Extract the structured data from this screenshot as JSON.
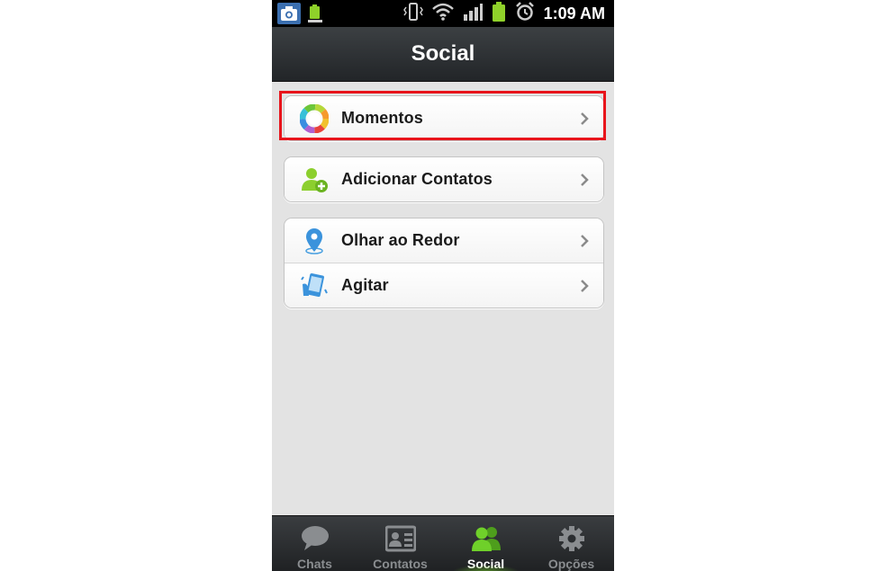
{
  "status_bar": {
    "time": "1:09 AM",
    "icons": [
      "camera-icon",
      "android-battery-notification-icon",
      "vibrate-icon",
      "wifi-icon",
      "signal-icon",
      "battery-icon",
      "alarm-icon"
    ]
  },
  "header": {
    "title": "Social"
  },
  "groups": [
    {
      "items": [
        {
          "label": "Momentos",
          "icon": "moments-icon"
        }
      ]
    },
    {
      "items": [
        {
          "label": "Adicionar Contatos",
          "icon": "add-contact-icon"
        }
      ]
    },
    {
      "items": [
        {
          "label": "Olhar ao Redor",
          "icon": "location-pin-icon"
        },
        {
          "label": "Agitar",
          "icon": "shake-phone-icon"
        }
      ]
    }
  ],
  "tabs": [
    {
      "label": "Chats",
      "icon": "chat-bubble-icon",
      "active": false
    },
    {
      "label": "Contatos",
      "icon": "contact-card-icon",
      "active": false
    },
    {
      "label": "Social",
      "icon": "people-icon",
      "active": true
    },
    {
      "label": "Opções",
      "icon": "gear-icon",
      "active": false
    }
  ],
  "colors": {
    "highlight": "#e8141b",
    "active_tab_green": "#66cc22",
    "titlebar": "#2a2d30",
    "background": "#e3e3e3"
  }
}
